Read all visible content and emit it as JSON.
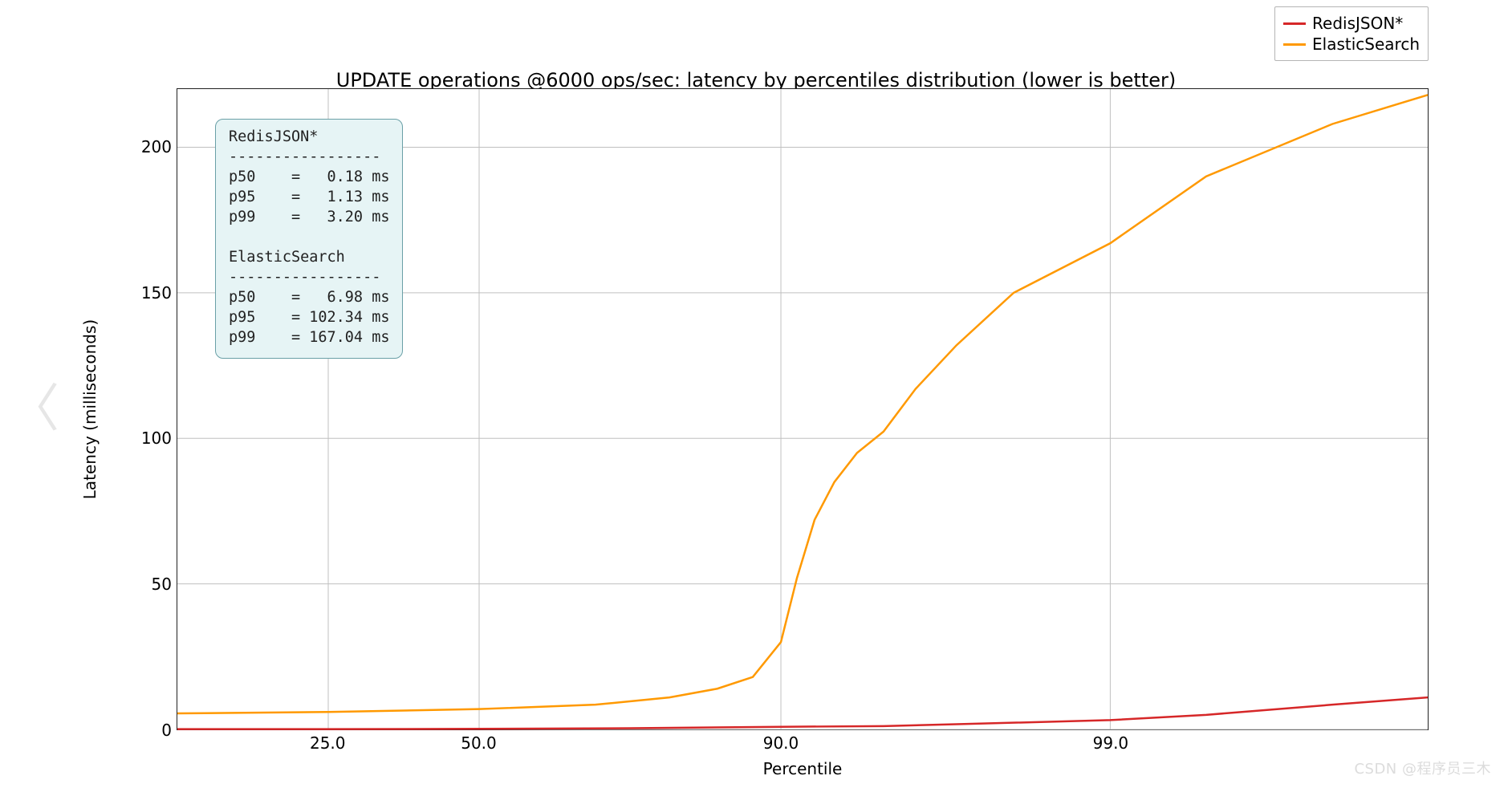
{
  "chart_data": {
    "type": "line",
    "title": "UPDATE operations @6000 ops/sec: latency by percentiles distribution (lower is better)",
    "xlabel": "Percentile",
    "ylabel": "Latency (milliseconds)",
    "ylim": [
      0,
      220
    ],
    "y_ticks": [
      0,
      50,
      100,
      150,
      200
    ],
    "x_tick_labels": [
      "25.0",
      "50.0",
      "90.0",
      "99.0"
    ],
    "x_tick_positions_logit": [
      25,
      50,
      90,
      99
    ],
    "x_domain_logit": [
      10,
      99.9
    ],
    "series": [
      {
        "name": "RedisJSON*",
        "color": "#d62728",
        "points": [
          {
            "percentile": 10,
            "latency_ms": 0.1
          },
          {
            "percentile": 25,
            "latency_ms": 0.12
          },
          {
            "percentile": 50,
            "latency_ms": 0.18
          },
          {
            "percentile": 75,
            "latency_ms": 0.4
          },
          {
            "percentile": 90,
            "latency_ms": 0.9
          },
          {
            "percentile": 95,
            "latency_ms": 1.13
          },
          {
            "percentile": 97,
            "latency_ms": 1.8
          },
          {
            "percentile": 99,
            "latency_ms": 3.2
          },
          {
            "percentile": 99.5,
            "latency_ms": 5.0
          },
          {
            "percentile": 99.8,
            "latency_ms": 8.5
          },
          {
            "percentile": 99.9,
            "latency_ms": 11.0
          }
        ]
      },
      {
        "name": "ElasticSearch",
        "color": "#ff9900",
        "points": [
          {
            "percentile": 10,
            "latency_ms": 5.5
          },
          {
            "percentile": 25,
            "latency_ms": 6.0
          },
          {
            "percentile": 50,
            "latency_ms": 6.98
          },
          {
            "percentile": 70,
            "latency_ms": 8.5
          },
          {
            "percentile": 80,
            "latency_ms": 11.0
          },
          {
            "percentile": 85,
            "latency_ms": 14.0
          },
          {
            "percentile": 88,
            "latency_ms": 18.0
          },
          {
            "percentile": 90,
            "latency_ms": 30.0
          },
          {
            "percentile": 91,
            "latency_ms": 52.0
          },
          {
            "percentile": 92,
            "latency_ms": 72.0
          },
          {
            "percentile": 93,
            "latency_ms": 85.0
          },
          {
            "percentile": 94,
            "latency_ms": 95.0
          },
          {
            "percentile": 95,
            "latency_ms": 102.34
          },
          {
            "percentile": 96,
            "latency_ms": 117.0
          },
          {
            "percentile": 97,
            "latency_ms": 132.0
          },
          {
            "percentile": 98,
            "latency_ms": 150.0
          },
          {
            "percentile": 99,
            "latency_ms": 167.04
          },
          {
            "percentile": 99.5,
            "latency_ms": 190.0
          },
          {
            "percentile": 99.8,
            "latency_ms": 208.0
          },
          {
            "percentile": 99.9,
            "latency_ms": 218.0
          }
        ]
      }
    ],
    "annotation_box": {
      "lines": [
        "RedisJSON*",
        "-----------------",
        "p50    =   0.18 ms",
        "p95    =   1.13 ms",
        "p99    =   3.20 ms",
        "",
        "ElasticSearch",
        "-----------------",
        "p50    =   6.98 ms",
        "p95    = 102.34 ms",
        "p99    = 167.04 ms"
      ]
    }
  },
  "legend": {
    "items": [
      "RedisJSON*",
      "ElasticSearch"
    ]
  },
  "watermark": "CSDN @程序员三木",
  "nav_prev_glyph": "〈"
}
